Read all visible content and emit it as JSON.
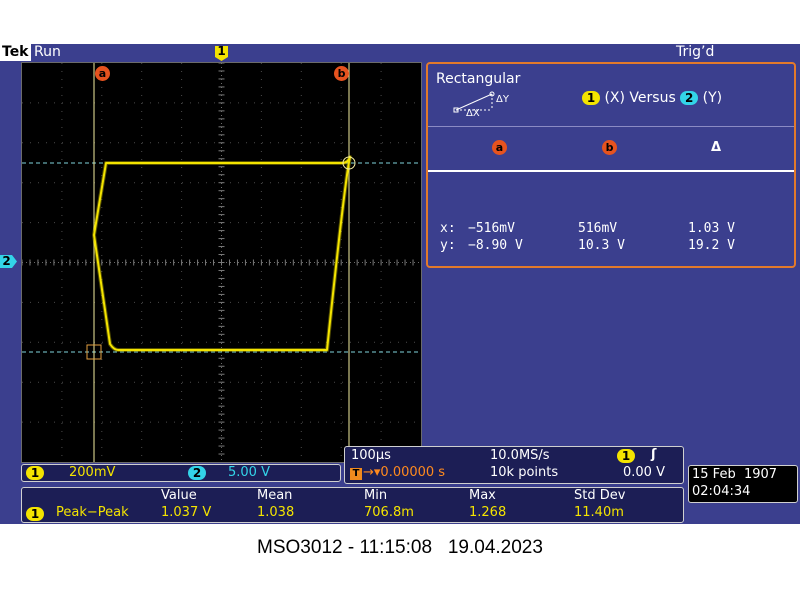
{
  "header": {
    "brand": "Tek",
    "status": "Run",
    "trigger_status": "Trig’d"
  },
  "channel1_marker": "1",
  "channel2_marker": "2",
  "cursors": {
    "a": "a",
    "b": "b"
  },
  "cursor_panel": {
    "mode": "Rectangular",
    "dx_label": "ΔX",
    "dy_label": "ΔY",
    "xy_ch_x": "1",
    "xy_label_x": "(X) Versus",
    "xy_ch_y": "2",
    "xy_label_y": "(Y)",
    "col_a": "a",
    "col_b": "b",
    "col_delta": "Δ",
    "rows": [
      {
        "label": "x:",
        "a": "−516mV",
        "b": "516mV",
        "delta": "1.03 V"
      },
      {
        "label": "y:",
        "a": "−8.90 V",
        "b": "10.3 V",
        "delta": "19.2 V"
      }
    ]
  },
  "channel_bar": {
    "ch1": "1",
    "ch1_scale": "200mV",
    "ch2": "2",
    "ch2_scale": "5.00 V"
  },
  "acquisition": {
    "timebase": "100µs",
    "sample_rate": "10.0MS/s",
    "trigger_channel": "1",
    "trigger_edge": "ʃ",
    "trigger_icon": "T",
    "trigger_position": "→▾0.00000 s",
    "record_length": "10k points",
    "trigger_level": "0.00 V"
  },
  "measurement": {
    "headers": [
      "Value",
      "Mean",
      "Min",
      "Max",
      "Std Dev"
    ],
    "channel": "1",
    "name": "Peak−Peak",
    "values": [
      "1.037 V",
      "1.038",
      "706.8m",
      "1.268",
      "11.40m"
    ]
  },
  "datetime": {
    "date": "15 Feb  1907",
    "time": "02:04:34"
  },
  "caption": "MSO3012 - 11:15:08   19.04.2023",
  "colors": {
    "ch1": "#f4e400",
    "ch2": "#33d4e8",
    "cursor": "#e6531f",
    "screen_bg": "#3b3f8e"
  }
}
